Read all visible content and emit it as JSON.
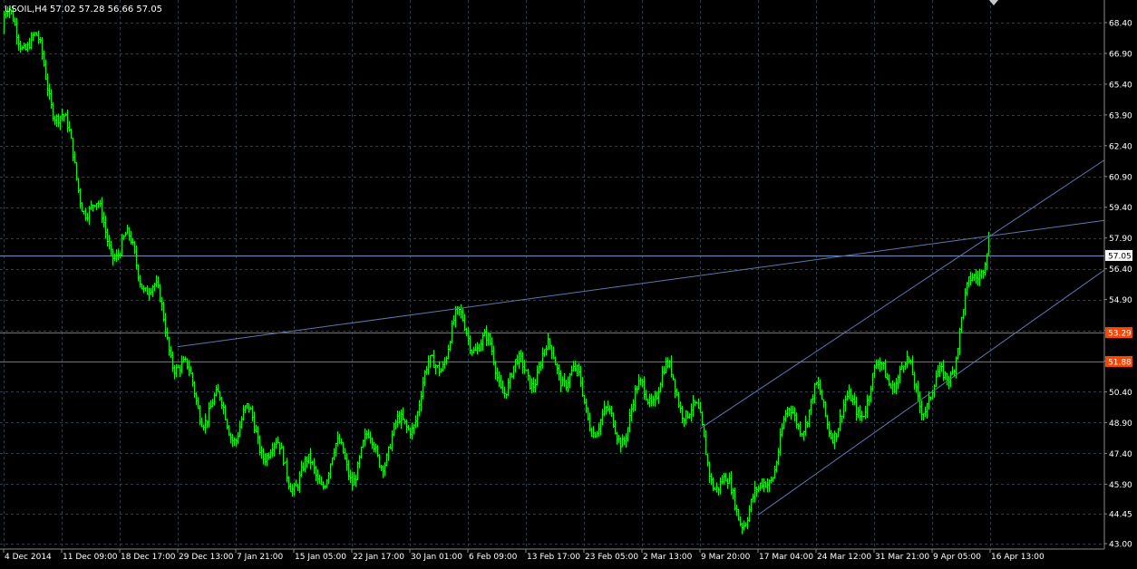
{
  "header": {
    "symbol_timeframe": "USOIL,H4",
    "ohlc": "57.02 57.28 56.66 57.05"
  },
  "colors": {
    "background": "#000000",
    "grid": "#2f3f4a",
    "candles": "#00ff00",
    "trendlines": "#5a78b0",
    "current_price_line": "#6f8fbf",
    "horizontal_levels": "#ff4400",
    "axis_text": "#ffffff",
    "current_price_badge_bg": "#ffffff",
    "current_price_badge_text": "#000000",
    "level_badge_bg": "#ff4400",
    "level_badge_text": "#ffffff"
  },
  "chart_data": {
    "type": "candlestick",
    "title": "USOIL,H4",
    "ylim": [
      42.9,
      69.2
    ],
    "y_ticks": [
      "68.40",
      "66.90",
      "65.40",
      "63.90",
      "62.40",
      "60.90",
      "59.40",
      "57.90",
      "56.40",
      "54.90",
      "53.40",
      "51.90",
      "50.40",
      "48.90",
      "47.40",
      "45.90",
      "44.45",
      "43.00"
    ],
    "x_ticks": [
      "4 Dec 2014",
      "11 Dec 09:00",
      "18 Dec 17:00",
      "29 Dec 13:00",
      "7 Jan 21:00",
      "15 Jan 05:00",
      "22 Jan 17:00",
      "30 Jan 01:00",
      "6 Feb 09:00",
      "13 Feb 17:00",
      "23 Feb 05:00",
      "2 Mar 13:00",
      "9 Mar 20:00",
      "17 Mar 04:00",
      "24 Mar 12:00",
      "31 Mar 21:00",
      "9 Apr 05:00",
      "16 Apr 13:00"
    ],
    "close_path": [
      {
        "date": "4 Dec 2014",
        "close": 67.9
      },
      {
        "date": "11 Dec 09:00",
        "close": 64.2
      },
      {
        "date": "18 Dec 17:00",
        "close": 56.5
      },
      {
        "date": "29 Dec 13:00",
        "close": 53.0
      },
      {
        "date": "7 Jan 21:00",
        "close": 47.5
      },
      {
        "date": "15 Jan 05:00",
        "close": 47.8
      },
      {
        "date": "22 Jan 17:00",
        "close": 45.5
      },
      {
        "date": "30 Jan 01:00",
        "close": 50.5
      },
      {
        "date": "6 Feb 09:00",
        "close": 52.5
      },
      {
        "date": "13 Feb 17:00",
        "close": 52.3
      },
      {
        "date": "23 Feb 05:00",
        "close": 49.2
      },
      {
        "date": "2 Mar 13:00",
        "close": 50.5
      },
      {
        "date": "9 Mar 20:00",
        "close": 48.5
      },
      {
        "date": "17 Mar 04:00",
        "close": 44.4
      },
      {
        "date": "24 Mar 12:00",
        "close": 50.6
      },
      {
        "date": "31 Mar 21:00",
        "close": 49.8
      },
      {
        "date": "9 Apr 05:00",
        "close": 51.2
      },
      {
        "date": "16 Apr 13:00",
        "close": 57.05
      }
    ],
    "current_price": {
      "label": "57.05",
      "value": 57.05
    },
    "horizontal_levels": [
      {
        "label": "53.29",
        "value": 53.29
      },
      {
        "label": "51.88",
        "value": 51.88
      }
    ],
    "trendlines": [
      {
        "from": {
          "date": "29 Dec 13:00",
          "price": 52.6
        },
        "to": {
          "date": "16 Apr 13:00",
          "price": 58.0
        },
        "extend_right": true
      },
      {
        "from": {
          "date": "9 Mar 20:00",
          "price": 48.6
        },
        "to": {
          "date": "16 Apr 13:00",
          "price": 58.0
        },
        "extend_right": true
      },
      {
        "from": {
          "date": "17 Mar 04:00",
          "price": 44.4
        },
        "to": {
          "date": "9 Apr 05:00",
          "price": 50.4
        },
        "extend_right": true
      }
    ]
  }
}
